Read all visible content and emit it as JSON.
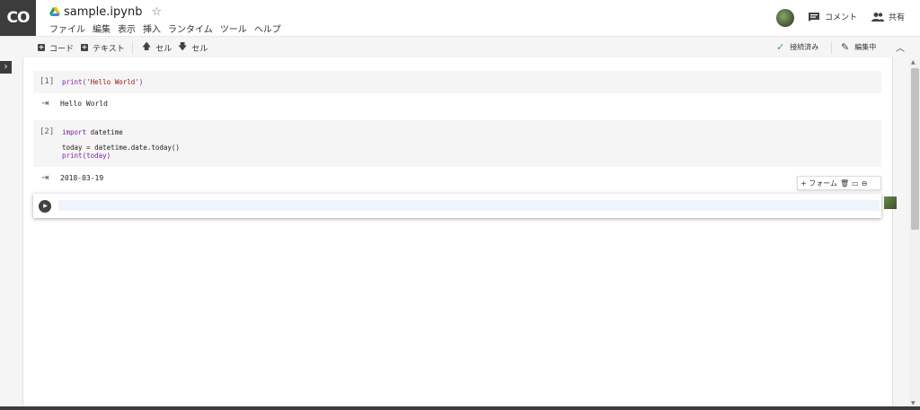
{
  "header": {
    "logo": "CO",
    "doc_title": "sample.ipynb",
    "star": "☆",
    "comment_label": "コメント",
    "share_label": "共有"
  },
  "menu": {
    "items": [
      "ファイル",
      "編集",
      "表示",
      "挿入",
      "ランタイム",
      "ツール",
      "ヘルプ"
    ]
  },
  "toolbar": {
    "add_code": "コード",
    "add_text": "テキスト",
    "cell_up": "セル",
    "cell_down": "セル",
    "status_connected": "接続済み",
    "status_editing": "編集中"
  },
  "cells": [
    {
      "prompt": "[1]",
      "code_parts": [
        "print(",
        "'Hello World'",
        ")"
      ],
      "output": "Hello World"
    },
    {
      "prompt": "[2]",
      "line1_kw": "import",
      "line1_rest": " datetime",
      "line2": "today = datetime.date.today()",
      "line3": "print(today)",
      "output": "2018-03-19"
    }
  ],
  "cell_toolbar": {
    "form_label": "+ フォーム"
  },
  "colors": {
    "logo_bg": "#3c3c3c",
    "connected_check": "#43a047",
    "keyword": "#7b1fa2",
    "string": "#a31515"
  }
}
